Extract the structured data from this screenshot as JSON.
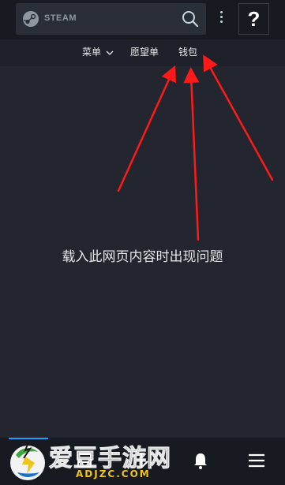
{
  "header": {
    "logo_text": "STEAM",
    "help_label": "?"
  },
  "nav": {
    "menu_label": "菜单",
    "wishlist_label": "愿望单",
    "wallet_label": "钱包"
  },
  "main": {
    "error_message": "载入此网页内容时出现问题"
  },
  "bottom_nav": {
    "icons": [
      "store-icon",
      "community-icon",
      "notifications-icon",
      "hamburger-menu-icon"
    ]
  },
  "watermark": {
    "title": "爱豆手游网",
    "domain": "ADJZC.COM"
  },
  "colors": {
    "background": "#23262e",
    "topbar": "#171a21",
    "accent": "#1a9fff",
    "arrow": "#ff1a1a"
  }
}
